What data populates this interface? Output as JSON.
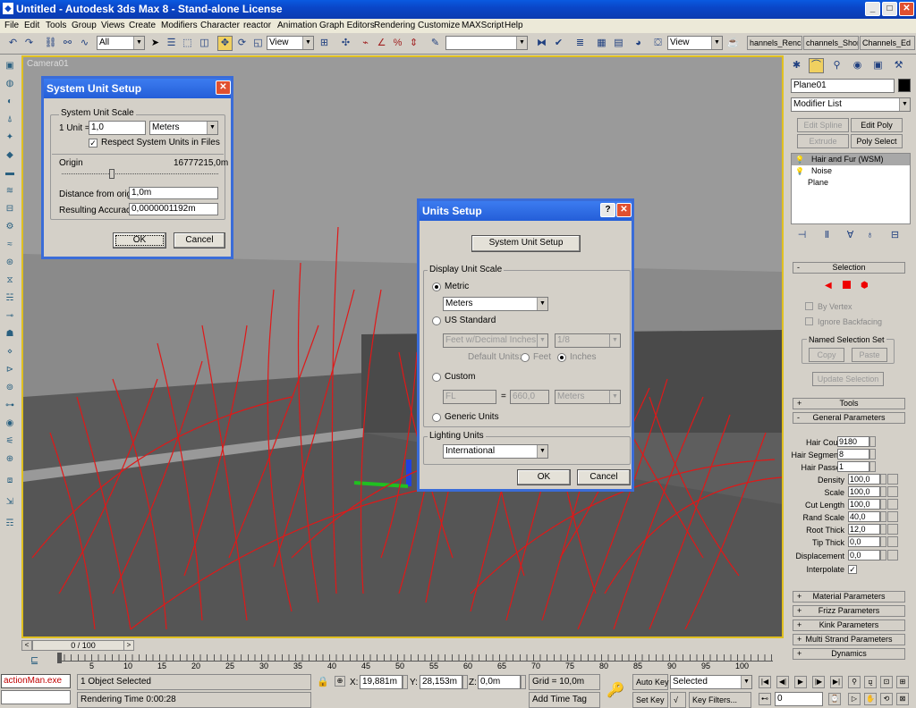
{
  "window": {
    "title": "Untitled - Autodesk 3ds Max 8 - Stand-alone License"
  },
  "menu": [
    "File",
    "Edit",
    "Tools",
    "Group",
    "Views",
    "Create",
    "Modifiers",
    "Character",
    "reactor",
    "Animation",
    "Graph Editors",
    "Rendering",
    "Customize",
    "MAXScript",
    "Help"
  ],
  "toolbar": {
    "selection_filter": "All",
    "ref_coord": "View",
    "ref_coord2": "View",
    "named_sel": "",
    "channel_tabs": [
      "hannels_Renc",
      "channels_Shor",
      "Channels_Ed"
    ]
  },
  "viewport": {
    "label": "Camera01"
  },
  "system_unit_dialog": {
    "title": "System Unit Setup",
    "group_title": "System Unit Scale",
    "unit_label": "1 Unit =",
    "unit_value": "1,0",
    "unit_type": "Meters",
    "respect_label": "Respect System Units in Files",
    "respect_checked": true,
    "origin_label": "Origin",
    "origin_value": "16777215,0m",
    "distance_label": "Distance from origin:",
    "distance_value": "1,0m",
    "accuracy_label": "Resulting Accuracy:",
    "accuracy_value": "0,0000001192m",
    "ok": "OK",
    "cancel": "Cancel"
  },
  "units_setup_dialog": {
    "title": "Units Setup",
    "system_unit_button": "System Unit Setup",
    "display_group": "Display Unit Scale",
    "metric_label": "Metric",
    "metric_value": "Meters",
    "us_label": "US Standard",
    "us_value": "Feet w/Decimal Inches",
    "us_fraction": "1/8",
    "default_units_label": "Default Units:",
    "feet_label": "Feet",
    "inches_label": "Inches",
    "custom_label": "Custom",
    "custom_name": "FL",
    "custom_equals": "=",
    "custom_value": "660,0",
    "custom_unit": "Meters",
    "generic_label": "Generic Units",
    "lighting_group": "Lighting Units",
    "lighting_value": "International",
    "ok": "OK",
    "cancel": "Cancel",
    "selected_option": "metric"
  },
  "command_panel": {
    "object_name": "Plane01",
    "object_color": "#000000",
    "modifier_list": "Modifier List",
    "buttons": [
      "Edit Spline",
      "Edit Poly",
      "Extrude",
      "Poly Select"
    ],
    "stack": [
      "Hair and Fur (WSM)",
      "Noise",
      "Plane"
    ],
    "selection_rollout": "Selection",
    "by_vertex": "By Vertex",
    "ignore_backfacing": "Ignore Backfacing",
    "named_selection_set": "Named Selection Set",
    "copy": "Copy",
    "paste": "Paste",
    "update_selection": "Update Selection",
    "tools_rollout": "Tools",
    "general_rollout": "General Parameters",
    "params": [
      {
        "label": "Hair Count",
        "value": "9180"
      },
      {
        "label": "Hair Segments",
        "value": "8"
      },
      {
        "label": "Hair Passes",
        "value": "1"
      },
      {
        "label": "Density",
        "value": "100,0"
      },
      {
        "label": "Scale",
        "value": "100,0"
      },
      {
        "label": "Cut Length",
        "value": "100,0"
      },
      {
        "label": "Rand Scale",
        "value": "40,0"
      },
      {
        "label": "Root Thick",
        "value": "12,0"
      },
      {
        "label": "Tip Thick",
        "value": "0,0"
      },
      {
        "label": "Displacement",
        "value": "0,0"
      }
    ],
    "interpolate_label": "Interpolate",
    "rollouts_bottom": [
      "Material Parameters",
      "Frizz Parameters",
      "Kink Parameters",
      "Multi Strand Parameters",
      "Dynamics"
    ]
  },
  "timeline": {
    "slider": "0 / 100",
    "ticks": [
      "5",
      "10",
      "15",
      "20",
      "25",
      "30",
      "35",
      "40",
      "45",
      "50",
      "55",
      "60",
      "65",
      "70",
      "75",
      "80",
      "85",
      "90",
      "95",
      "100"
    ]
  },
  "status": {
    "script_listener": "actionMan.exe",
    "selected_text": "1 Object Selected",
    "render_time": "Rendering Time  0:00:28",
    "x_label": "X:",
    "x_value": "19,881m",
    "y_label": "Y:",
    "y_value": "28,153m",
    "z_label": "Z:",
    "z_value": "0,0m",
    "grid": "Grid = 10,0m",
    "add_time_tag": "Add Time Tag",
    "auto_key": "Auto Key",
    "set_key": "Set Key",
    "selected_dropdown": "Selected",
    "key_filters": "Key Filters...",
    "frame": "0"
  }
}
